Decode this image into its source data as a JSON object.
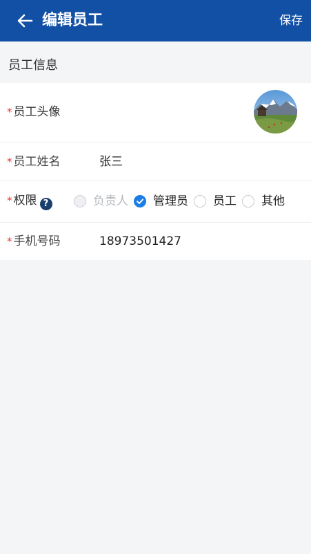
{
  "header": {
    "title": "编辑员工",
    "save_label": "保存",
    "back_icon": "arrow-left-icon",
    "bg_color": "#1250a5"
  },
  "section": {
    "title": "员工信息"
  },
  "form": {
    "required_mark": "*",
    "avatar": {
      "label": "员工头像"
    },
    "name": {
      "label": "员工姓名",
      "value": "张三"
    },
    "permission": {
      "label": "权限",
      "help_glyph": "?",
      "options": [
        {
          "label": "负责人",
          "state": "disabled"
        },
        {
          "label": "管理员",
          "state": "checked"
        },
        {
          "label": "员工",
          "state": "unchecked"
        },
        {
          "label": "其他",
          "state": "unchecked"
        }
      ]
    },
    "phone": {
      "label": "手机号码",
      "value": "18973501427"
    }
  },
  "colors": {
    "accent": "#1a7ee6",
    "required": "#e53935",
    "page_bg": "#f4f5f7"
  }
}
